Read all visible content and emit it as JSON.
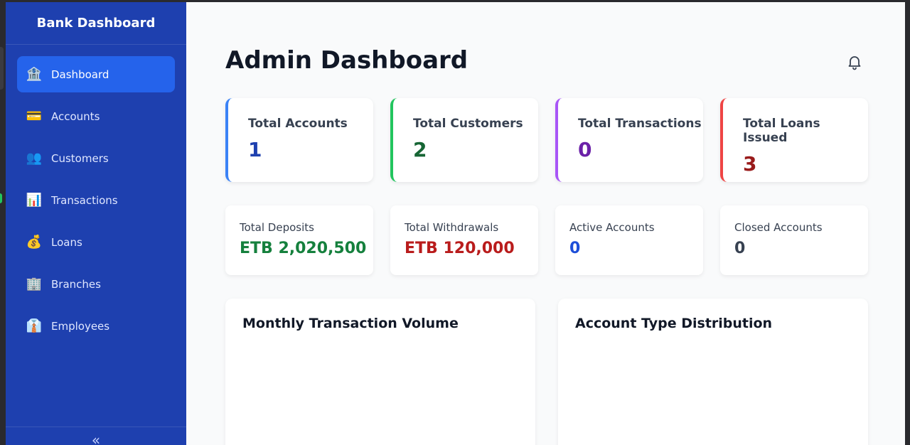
{
  "sidebar": {
    "brand": "Bank Dashboard",
    "items": [
      {
        "label": "Dashboard",
        "icon": "🏦"
      },
      {
        "label": "Accounts",
        "icon": "💳"
      },
      {
        "label": "Customers",
        "icon": "👥"
      },
      {
        "label": "Transactions",
        "icon": "📊"
      },
      {
        "label": "Loans",
        "icon": "💰"
      },
      {
        "label": "Branches",
        "icon": "🏢"
      },
      {
        "label": "Employees",
        "icon": "👔"
      }
    ],
    "collapse_icon": "«"
  },
  "header": {
    "title": "Admin Dashboard"
  },
  "stats": [
    {
      "label": "Total Accounts",
      "value": "1",
      "accent": "#3b82f6",
      "value_color": "#1e40af"
    },
    {
      "label": "Total Customers",
      "value": "2",
      "accent": "#22c55e",
      "value_color": "#166534"
    },
    {
      "label": "Total Transactions",
      "value": "0",
      "accent": "#a855f7",
      "value_color": "#6b21a8"
    },
    {
      "label": "Total Loans Issued",
      "value": "3",
      "accent": "#ef4444",
      "value_color": "#991b1b"
    }
  ],
  "mini_stats": [
    {
      "label": "Total Deposits",
      "value": "ETB 2,020,500",
      "value_color": "#15803d"
    },
    {
      "label": "Total Withdrawals",
      "value": "ETB 120,000",
      "value_color": "#b91c1c"
    },
    {
      "label": "Active Accounts",
      "value": "0",
      "value_color": "#1d4ed8"
    },
    {
      "label": "Closed Accounts",
      "value": "0",
      "value_color": "#374151"
    }
  ],
  "panels": [
    {
      "title": "Monthly Transaction Volume"
    },
    {
      "title": "Account Type Distribution"
    }
  ]
}
